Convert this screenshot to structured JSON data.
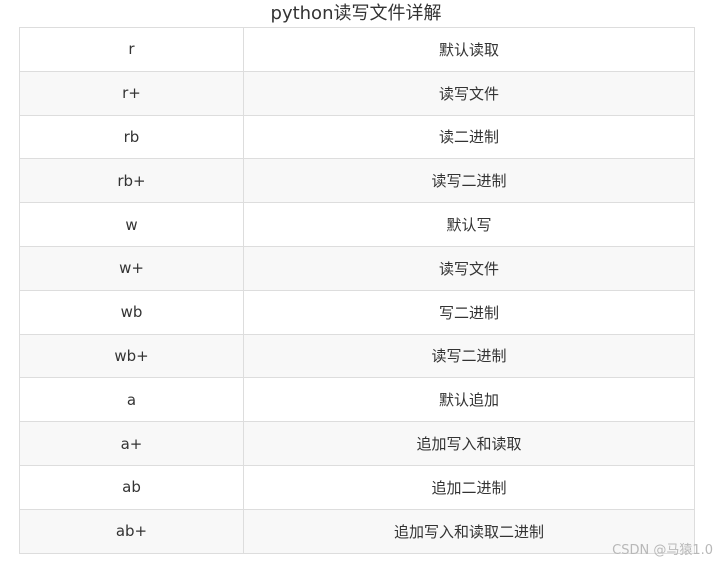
{
  "caption": "python读写文件详解",
  "rows": [
    {
      "mode": "r",
      "desc": "默认读取"
    },
    {
      "mode": "r+",
      "desc": "读写文件"
    },
    {
      "mode": "rb",
      "desc": "读二进制"
    },
    {
      "mode": "rb+",
      "desc": "读写二进制"
    },
    {
      "mode": "w",
      "desc": "默认写"
    },
    {
      "mode": "w+",
      "desc": "读写文件"
    },
    {
      "mode": "wb",
      "desc": "写二进制"
    },
    {
      "mode": "wb+",
      "desc": "读写二进制"
    },
    {
      "mode": "a",
      "desc": "默认追加"
    },
    {
      "mode": "a+",
      "desc": "追加写入和读取"
    },
    {
      "mode": "ab",
      "desc": "追加二进制"
    },
    {
      "mode": "ab+",
      "desc": "追加写入和读取二进制"
    }
  ],
  "watermark": "CSDN @马猿1.0"
}
